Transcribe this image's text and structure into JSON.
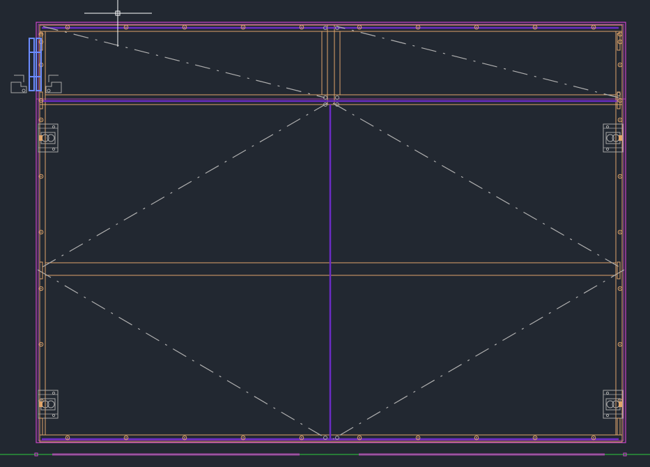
{
  "drawing": {
    "colors": {
      "background": "#222831",
      "frame": "#e0a56a",
      "outline": "#cc44cc",
      "divider": "#6a2cc4",
      "hinge": "#a8a8a8",
      "hardware_blue": "#6c8cff",
      "centerline": "#b0b0b0",
      "crosshair": "#ffffff",
      "ground": "#2ecc40"
    },
    "cursor": {
      "type": "crosshair-pickbox"
    }
  }
}
